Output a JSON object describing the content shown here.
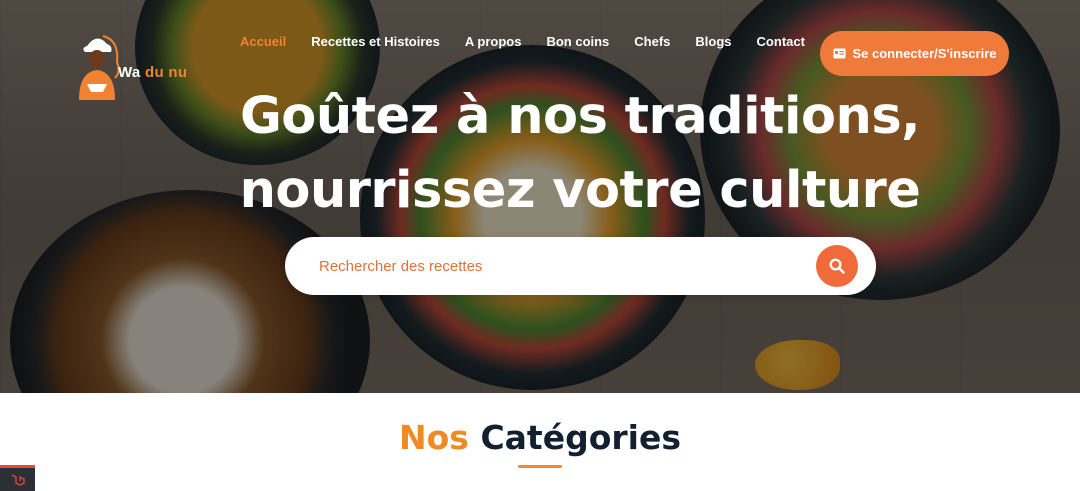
{
  "brand": {
    "name_part1": "Wa",
    "name_part2": "du nu",
    "accent_color": "#f08232"
  },
  "nav": {
    "items": [
      {
        "label": "Accueil",
        "active": true
      },
      {
        "label": "Recettes et Histoires",
        "active": false
      },
      {
        "label": "A propos",
        "active": false
      },
      {
        "label": "Bon coins",
        "active": false
      },
      {
        "label": "Chefs",
        "active": false
      },
      {
        "label": "Blogs",
        "active": false
      },
      {
        "label": "Contact",
        "active": false
      }
    ],
    "login_label": "Se connecter/S'inscrire",
    "login_icon": "id-card-icon"
  },
  "hero": {
    "headline_line1": "Goûtez à nos traditions,",
    "headline_line2": "nourrissez votre culture"
  },
  "search": {
    "placeholder": "Rechercher des recettes",
    "button_icon": "search-icon"
  },
  "categories": {
    "title_accent": "Nos",
    "title_rest": "Catégories"
  },
  "colors": {
    "primary": "#f07a3a",
    "dark_text": "#13202f"
  }
}
